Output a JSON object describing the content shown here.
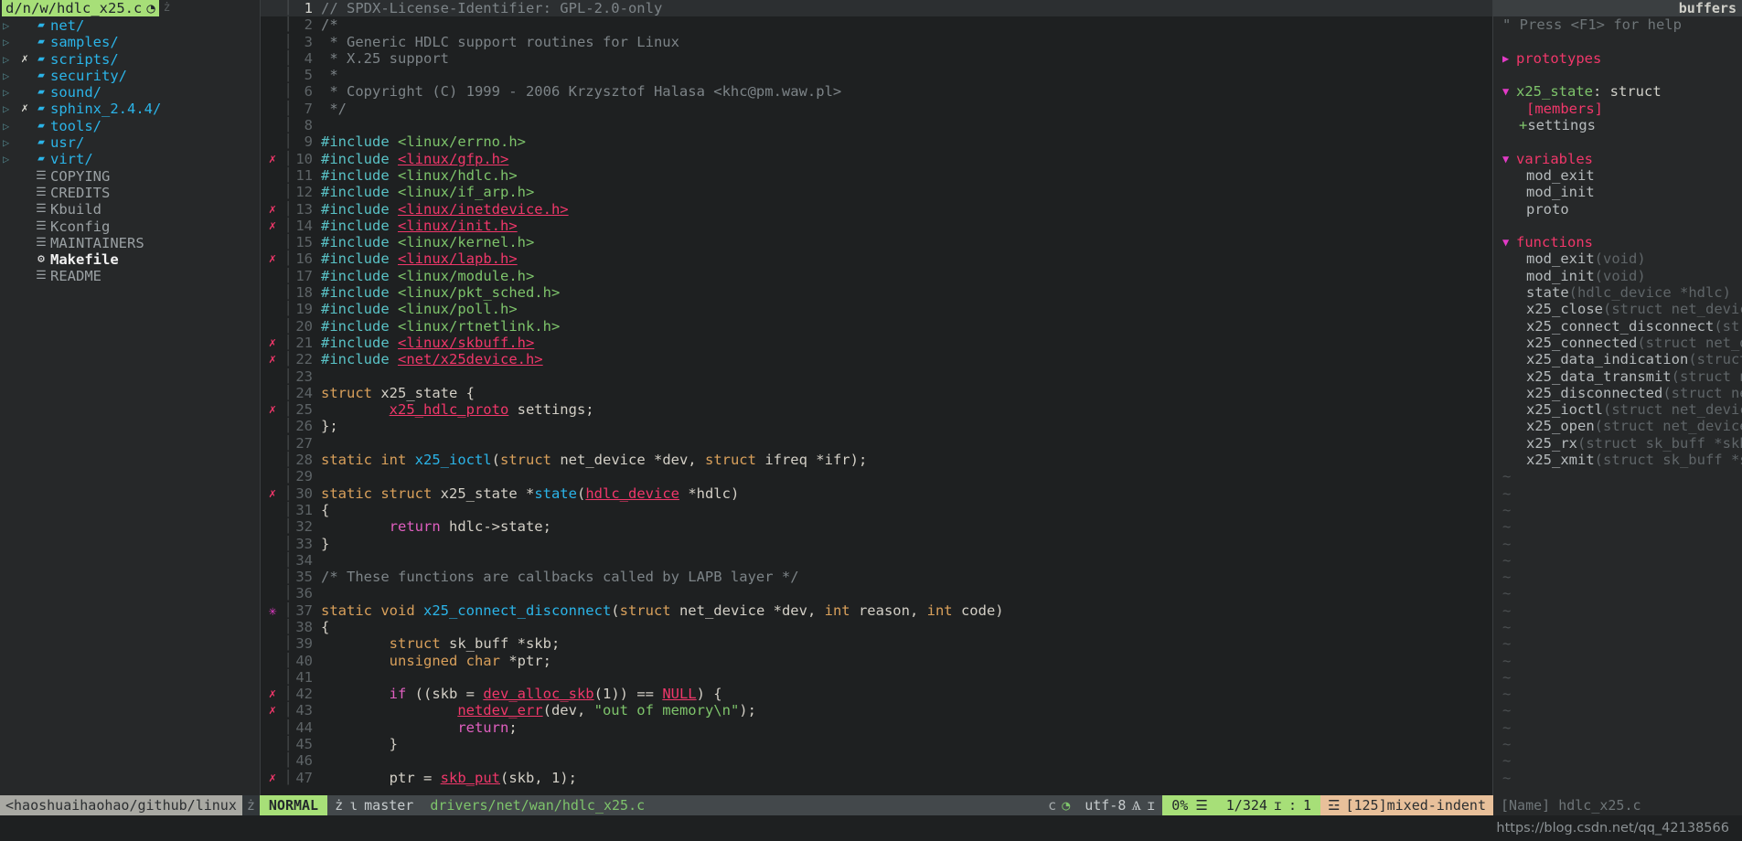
{
  "sidebar": {
    "header": {
      "path": "d/n/w/hdlc_x25.c",
      "icon": "git-icon",
      "extra": "ż"
    },
    "items": [
      {
        "arrow": "▷",
        "flag": "",
        "icon": "folder-icon",
        "label": "net/",
        "type": "dir"
      },
      {
        "arrow": "▷",
        "flag": "",
        "icon": "folder-icon",
        "label": "samples/",
        "type": "dir"
      },
      {
        "arrow": "▷",
        "flag": "✗",
        "icon": "folder-icon",
        "label": "scripts/",
        "type": "dir"
      },
      {
        "arrow": "▷",
        "flag": "",
        "icon": "folder-icon",
        "label": "security/",
        "type": "dir"
      },
      {
        "arrow": "▷",
        "flag": "",
        "icon": "folder-icon",
        "label": "sound/",
        "type": "dir"
      },
      {
        "arrow": "▷",
        "flag": "✗",
        "icon": "folder-icon",
        "label": "sphinx_2.4.4/",
        "type": "dir"
      },
      {
        "arrow": "▷",
        "flag": "",
        "icon": "folder-icon",
        "label": "tools/",
        "type": "dir"
      },
      {
        "arrow": "▷",
        "flag": "",
        "icon": "folder-icon",
        "label": "usr/",
        "type": "dir"
      },
      {
        "arrow": "▷",
        "flag": "",
        "icon": "folder-icon",
        "label": "virt/",
        "type": "dir"
      },
      {
        "arrow": "",
        "flag": "",
        "icon": "file-icon",
        "label": "COPYING",
        "type": "file"
      },
      {
        "arrow": "",
        "flag": "",
        "icon": "file-icon",
        "label": "CREDITS",
        "type": "file"
      },
      {
        "arrow": "",
        "flag": "",
        "icon": "file-icon",
        "label": "Kbuild",
        "type": "file"
      },
      {
        "arrow": "",
        "flag": "",
        "icon": "file-icon",
        "label": "Kconfig",
        "type": "file"
      },
      {
        "arrow": "",
        "flag": "",
        "icon": "file-icon",
        "label": "MAINTAINERS",
        "type": "file"
      },
      {
        "arrow": "",
        "flag": "",
        "icon": "gear-icon",
        "label": "Makefile",
        "type": "bold"
      },
      {
        "arrow": "",
        "flag": "",
        "icon": "file-icon",
        "label": "README",
        "type": "file"
      }
    ]
  },
  "editor": {
    "lines": [
      {
        "n": "1",
        "sign": "",
        "cursor": true,
        "tokens": [
          {
            "t": "// SPDX-License-Identifier: GPL-2.0-only",
            "c": "c-cmt"
          }
        ]
      },
      {
        "n": "2",
        "sign": "",
        "tokens": [
          {
            "t": "/*",
            "c": "c-cmt"
          }
        ]
      },
      {
        "n": "3",
        "sign": "",
        "tokens": [
          {
            "t": " * Generic HDLC support routines for Linux",
            "c": "c-cmt"
          }
        ]
      },
      {
        "n": "4",
        "sign": "",
        "tokens": [
          {
            "t": " * X.25 support",
            "c": "c-cmt"
          }
        ]
      },
      {
        "n": "5",
        "sign": "",
        "tokens": [
          {
            "t": " *",
            "c": "c-cmt"
          }
        ]
      },
      {
        "n": "6",
        "sign": "",
        "tokens": [
          {
            "t": " * Copyright (C) 1999 - 2006 Krzysztof Halasa <khc@pm.waw.pl>",
            "c": "c-cmt"
          }
        ]
      },
      {
        "n": "7",
        "sign": "",
        "tokens": [
          {
            "t": " */",
            "c": "c-cmt"
          }
        ]
      },
      {
        "n": "8",
        "sign": "",
        "tokens": []
      },
      {
        "n": "9",
        "sign": "",
        "tokens": [
          {
            "t": "#include ",
            "c": "c-pp"
          },
          {
            "t": "<linux/errno.h>",
            "c": "c-str"
          }
        ]
      },
      {
        "n": "10",
        "sign": "err",
        "tokens": [
          {
            "t": "#include ",
            "c": "c-pp"
          },
          {
            "t": "<linux/gfp.h>",
            "c": "c-err"
          }
        ]
      },
      {
        "n": "11",
        "sign": "",
        "tokens": [
          {
            "t": "#include ",
            "c": "c-pp"
          },
          {
            "t": "<linux/hdlc.h>",
            "c": "c-str"
          }
        ]
      },
      {
        "n": "12",
        "sign": "",
        "tokens": [
          {
            "t": "#include ",
            "c": "c-pp"
          },
          {
            "t": "<linux/if_arp.h>",
            "c": "c-str"
          }
        ]
      },
      {
        "n": "13",
        "sign": "err",
        "tokens": [
          {
            "t": "#include ",
            "c": "c-pp"
          },
          {
            "t": "<linux/inetdevice.h>",
            "c": "c-err"
          }
        ]
      },
      {
        "n": "14",
        "sign": "err",
        "tokens": [
          {
            "t": "#include ",
            "c": "c-pp"
          },
          {
            "t": "<linux/init.h>",
            "c": "c-err"
          }
        ]
      },
      {
        "n": "15",
        "sign": "",
        "tokens": [
          {
            "t": "#include ",
            "c": "c-pp"
          },
          {
            "t": "<linux/kernel.h>",
            "c": "c-str"
          }
        ]
      },
      {
        "n": "16",
        "sign": "err",
        "tokens": [
          {
            "t": "#include ",
            "c": "c-pp"
          },
          {
            "t": "<linux/lapb.h>",
            "c": "c-err"
          }
        ]
      },
      {
        "n": "17",
        "sign": "",
        "tokens": [
          {
            "t": "#include ",
            "c": "c-pp"
          },
          {
            "t": "<linux/module.h>",
            "c": "c-str"
          }
        ]
      },
      {
        "n": "18",
        "sign": "",
        "tokens": [
          {
            "t": "#include ",
            "c": "c-pp"
          },
          {
            "t": "<linux/pkt_sched.h>",
            "c": "c-str"
          }
        ]
      },
      {
        "n": "19",
        "sign": "",
        "tokens": [
          {
            "t": "#include ",
            "c": "c-pp"
          },
          {
            "t": "<linux/poll.h>",
            "c": "c-str"
          }
        ]
      },
      {
        "n": "20",
        "sign": "",
        "tokens": [
          {
            "t": "#include ",
            "c": "c-pp"
          },
          {
            "t": "<linux/rtnetlink.h>",
            "c": "c-str"
          }
        ]
      },
      {
        "n": "21",
        "sign": "err",
        "tokens": [
          {
            "t": "#include ",
            "c": "c-pp"
          },
          {
            "t": "<linux/skbuff.h>",
            "c": "c-err"
          }
        ]
      },
      {
        "n": "22",
        "sign": "err",
        "tokens": [
          {
            "t": "#include ",
            "c": "c-pp"
          },
          {
            "t": "<net/x25device.h>",
            "c": "c-err"
          }
        ]
      },
      {
        "n": "23",
        "sign": "",
        "tokens": []
      },
      {
        "n": "24",
        "sign": "",
        "tokens": [
          {
            "t": "struct",
            "c": "c-type"
          },
          {
            "t": " x25_state {",
            "c": "c-txt"
          }
        ]
      },
      {
        "n": "25",
        "sign": "err",
        "tokens": [
          {
            "t": "        ",
            "c": "c-txt"
          },
          {
            "t": "x25_hdlc_proto",
            "c": "c-err"
          },
          {
            "t": " settings;",
            "c": "c-txt"
          }
        ]
      },
      {
        "n": "26",
        "sign": "",
        "tokens": [
          {
            "t": "};",
            "c": "c-txt"
          }
        ]
      },
      {
        "n": "27",
        "sign": "",
        "tokens": []
      },
      {
        "n": "28",
        "sign": "",
        "tokens": [
          {
            "t": "static int ",
            "c": "c-type"
          },
          {
            "t": "x25_ioctl",
            "c": "c-fn"
          },
          {
            "t": "(",
            "c": "c-txt"
          },
          {
            "t": "struct",
            "c": "c-type"
          },
          {
            "t": " net_device *dev, ",
            "c": "c-txt"
          },
          {
            "t": "struct",
            "c": "c-type"
          },
          {
            "t": " ifreq *ifr);",
            "c": "c-txt"
          }
        ]
      },
      {
        "n": "29",
        "sign": "",
        "tokens": []
      },
      {
        "n": "30",
        "sign": "err",
        "tokens": [
          {
            "t": "static struct",
            "c": "c-type"
          },
          {
            "t": " x25_state *",
            "c": "c-txt"
          },
          {
            "t": "state",
            "c": "c-fn"
          },
          {
            "t": "(",
            "c": "c-txt"
          },
          {
            "t": "hdlc_device",
            "c": "c-err"
          },
          {
            "t": " *hdlc)",
            "c": "c-txt"
          }
        ]
      },
      {
        "n": "31",
        "sign": "",
        "tokens": [
          {
            "t": "{",
            "c": "c-txt"
          }
        ]
      },
      {
        "n": "32",
        "sign": "",
        "tokens": [
          {
            "t": "        ",
            "c": "c-txt"
          },
          {
            "t": "return",
            "c": "c-ret"
          },
          {
            "t": " hdlc->state;",
            "c": "c-txt"
          }
        ]
      },
      {
        "n": "33",
        "sign": "",
        "tokens": [
          {
            "t": "}",
            "c": "c-txt"
          }
        ]
      },
      {
        "n": "34",
        "sign": "",
        "tokens": []
      },
      {
        "n": "35",
        "sign": "",
        "tokens": [
          {
            "t": "/* These functions are callbacks called by LAPB layer */",
            "c": "c-cmt"
          }
        ]
      },
      {
        "n": "36",
        "sign": "",
        "tokens": []
      },
      {
        "n": "37",
        "sign": "mark",
        "tokens": [
          {
            "t": "static void ",
            "c": "c-type"
          },
          {
            "t": "x25_connect_disconnect",
            "c": "c-fn"
          },
          {
            "t": "(",
            "c": "c-txt"
          },
          {
            "t": "struct",
            "c": "c-type"
          },
          {
            "t": " net_device *dev, ",
            "c": "c-txt"
          },
          {
            "t": "int",
            "c": "c-type"
          },
          {
            "t": " reason, ",
            "c": "c-txt"
          },
          {
            "t": "int",
            "c": "c-type"
          },
          {
            "t": " code)",
            "c": "c-txt"
          }
        ]
      },
      {
        "n": "38",
        "sign": "",
        "tokens": [
          {
            "t": "{",
            "c": "c-txt"
          }
        ]
      },
      {
        "n": "39",
        "sign": "",
        "tokens": [
          {
            "t": "        ",
            "c": "c-txt"
          },
          {
            "t": "struct",
            "c": "c-type"
          },
          {
            "t": " sk_buff *skb;",
            "c": "c-txt"
          }
        ]
      },
      {
        "n": "40",
        "sign": "",
        "tokens": [
          {
            "t": "        ",
            "c": "c-txt"
          },
          {
            "t": "unsigned char",
            "c": "c-type"
          },
          {
            "t": " *ptr;",
            "c": "c-txt"
          }
        ]
      },
      {
        "n": "41",
        "sign": "",
        "tokens": []
      },
      {
        "n": "42",
        "sign": "err",
        "tokens": [
          {
            "t": "        ",
            "c": "c-txt"
          },
          {
            "t": "if",
            "c": "c-ret"
          },
          {
            "t": " ((skb = ",
            "c": "c-txt"
          },
          {
            "t": "dev_alloc_skb",
            "c": "c-err"
          },
          {
            "t": "(1)) == ",
            "c": "c-txt"
          },
          {
            "t": "NULL",
            "c": "c-err"
          },
          {
            "t": ") {",
            "c": "c-txt"
          }
        ]
      },
      {
        "n": "43",
        "sign": "err",
        "tokens": [
          {
            "t": "                ",
            "c": "c-txt"
          },
          {
            "t": "netdev_err",
            "c": "c-err"
          },
          {
            "t": "(dev, ",
            "c": "c-txt"
          },
          {
            "t": "\"out of memory\\n\"",
            "c": "c-str"
          },
          {
            "t": ");",
            "c": "c-txt"
          }
        ]
      },
      {
        "n": "44",
        "sign": "",
        "tokens": [
          {
            "t": "                ",
            "c": "c-txt"
          },
          {
            "t": "return",
            "c": "c-ret"
          },
          {
            "t": ";",
            "c": "c-txt"
          }
        ]
      },
      {
        "n": "45",
        "sign": "",
        "tokens": [
          {
            "t": "        }",
            "c": "c-txt"
          }
        ]
      },
      {
        "n": "46",
        "sign": "",
        "tokens": []
      },
      {
        "n": "47",
        "sign": "err",
        "tokens": [
          {
            "t": "        ptr = ",
            "c": "c-txt"
          },
          {
            "t": "skb_put",
            "c": "c-err"
          },
          {
            "t": "(skb, 1);",
            "c": "c-txt"
          }
        ]
      }
    ]
  },
  "tagbar": {
    "header": "buffers",
    "help": "\" Press <F1> for help",
    "groups": [
      {
        "triangle": "▶",
        "label": "prototypes",
        "kind": "scope",
        "items": []
      },
      {
        "triangle": "▼",
        "label": "x25_state",
        "kind": "struct",
        "type_label": " : struct",
        "members_label": "[members]",
        "items": [
          {
            "prefix": "+",
            "name": "settings",
            "sig": ""
          }
        ]
      },
      {
        "triangle": "▼",
        "label": "variables",
        "kind": "scope",
        "items": [
          {
            "prefix": "",
            "name": "mod_exit",
            "sig": ""
          },
          {
            "prefix": "",
            "name": "mod_init",
            "sig": ""
          },
          {
            "prefix": "",
            "name": "proto",
            "sig": ""
          }
        ]
      },
      {
        "triangle": "▼",
        "label": "functions",
        "kind": "scope",
        "items": [
          {
            "prefix": "",
            "name": "mod_exit",
            "sig": "(void)"
          },
          {
            "prefix": "",
            "name": "mod_init",
            "sig": "(void)"
          },
          {
            "prefix": "",
            "name": "state",
            "sig": "(hdlc_device *hdlc)"
          },
          {
            "prefix": "",
            "name": "x25_close",
            "sig": "(struct net_device"
          },
          {
            "prefix": "",
            "name": "x25_connect_disconnect",
            "sig": "(str"
          },
          {
            "prefix": "",
            "name": "x25_connected",
            "sig": "(struct net_d"
          },
          {
            "prefix": "",
            "name": "x25_data_indication",
            "sig": "(struct"
          },
          {
            "prefix": "",
            "name": "x25_data_transmit",
            "sig": "(struct n"
          },
          {
            "prefix": "",
            "name": "x25_disconnected",
            "sig": "(struct ne"
          },
          {
            "prefix": "",
            "name": "x25_ioctl",
            "sig": "(struct net_device"
          },
          {
            "prefix": "",
            "name": "x25_open",
            "sig": "(struct net_device"
          },
          {
            "prefix": "",
            "name": "x25_rx",
            "sig": "(struct sk_buff *skb"
          },
          {
            "prefix": "",
            "name": "x25_xmit",
            "sig": "(struct sk_buff *s"
          }
        ]
      }
    ]
  },
  "statusline": {
    "cwd": "<haoshuaihaohao/github/linux",
    "cwd_sep": "ż",
    "mode": "NORMAL",
    "mode_sep": "ż",
    "branch_icon": "ɩ",
    "branch": "master",
    "filepath": "drivers/net/wan/hdlc_x25.c",
    "filetype": "c",
    "filetype_icon": "git-icon",
    "encoding": "utf-8",
    "encoding_icon": "Ѧ",
    "sep_left": "ɪ",
    "percent": "0%",
    "percent_icon": "☰",
    "position": "1/324",
    "position_icon": "ɪ",
    "colon": ":",
    "column": "1",
    "warn_icon": "☲",
    "warning": "[125]mixed-indent",
    "tagbar_name": "[Name] hdlc_x25.c"
  },
  "watermark": "https://blog.csdn.net/qq_42138566"
}
